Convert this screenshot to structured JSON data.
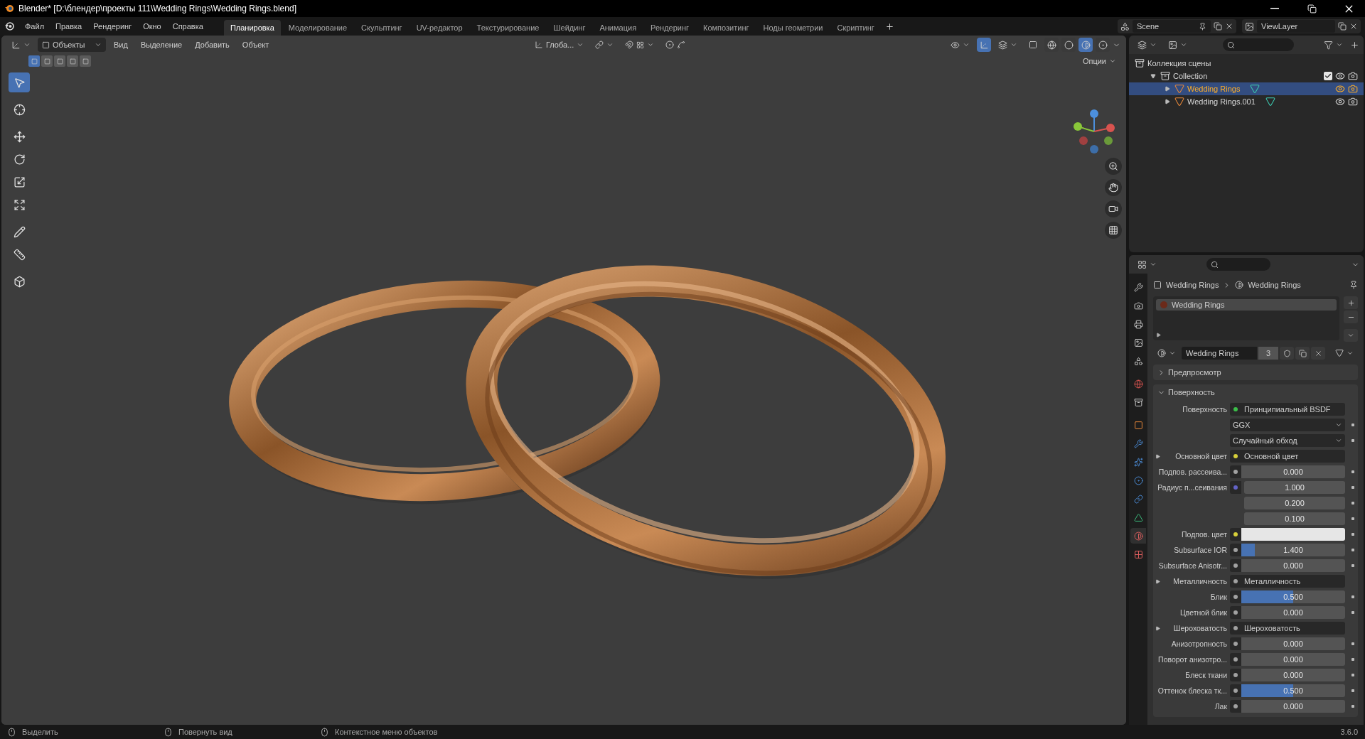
{
  "window": {
    "title": "Blender* [D:\\блендер\\проекты 111\\Wedding Rings\\Wedding Rings.blend]"
  },
  "menu": [
    "Файл",
    "Правка",
    "Рендеринг",
    "Окно",
    "Справка"
  ],
  "workspaces": [
    {
      "label": "Планировка",
      "selected": true
    },
    {
      "label": "Моделирование",
      "selected": false
    },
    {
      "label": "Скульптинг",
      "selected": false
    },
    {
      "label": "UV-редактор",
      "selected": false
    },
    {
      "label": "Текстурирование",
      "selected": false
    },
    {
      "label": "Шейдинг",
      "selected": false
    },
    {
      "label": "Анимация",
      "selected": false
    },
    {
      "label": "Рендеринг",
      "selected": false
    },
    {
      "label": "Композитинг",
      "selected": false
    },
    {
      "label": "Ноды геометрии",
      "selected": false
    },
    {
      "label": "Скриптинг",
      "selected": false
    }
  ],
  "scene": "Scene",
  "view_layer": "ViewLayer",
  "viewport": {
    "mode": "Объекты",
    "menus": [
      "Вид",
      "Выделение",
      "Добавить",
      "Объект"
    ],
    "orientation": "Глоба...",
    "options": "Опции",
    "select_modes": [
      {
        "selected": true
      },
      {
        "selected": false
      },
      {
        "selected": false
      },
      {
        "selected": false
      },
      {
        "selected": false
      }
    ],
    "gizmo_toggle": {
      "on": true
    },
    "shading": [
      {
        "kind": "wireframe",
        "selected": false
      },
      {
        "kind": "solid",
        "selected": false
      },
      {
        "kind": "material",
        "selected": true
      },
      {
        "kind": "rendered",
        "selected": false
      }
    ]
  },
  "toolbar": [
    {
      "kind": "select",
      "selected": true
    },
    {
      "kind": "cursor",
      "selected": false
    },
    {
      "kind": "move",
      "selected": false
    },
    {
      "kind": "rotate",
      "selected": false
    },
    {
      "kind": "scale",
      "selected": false
    },
    {
      "kind": "transform",
      "selected": false
    },
    {
      "kind": "annotate",
      "selected": false
    },
    {
      "kind": "measure",
      "selected": false
    },
    {
      "kind": "add_cube",
      "selected": false
    }
  ],
  "outliner": {
    "label": "Коллекция сцены",
    "children": [
      {
        "label": "Collection",
        "kind": "collection",
        "expanded": true,
        "checked": true,
        "selected": false,
        "children": [
          {
            "label": "Wedding Rings",
            "kind": "mesh",
            "expanded": false,
            "selected": true
          },
          {
            "label": "Wedding Rings.001",
            "kind": "mesh",
            "expanded": false,
            "selected": false
          }
        ]
      }
    ]
  },
  "properties": {
    "tabs": [
      {
        "kind": "tool",
        "selected": false
      },
      {
        "kind": "render",
        "selected": false
      },
      {
        "kind": "output",
        "selected": false
      },
      {
        "kind": "view_layer",
        "selected": false
      },
      {
        "kind": "scene",
        "selected": false
      },
      {
        "kind": "world",
        "selected": false
      },
      {
        "kind": "collection",
        "selected": false
      },
      {
        "kind": "object",
        "selected": false
      },
      {
        "kind": "modifier",
        "selected": false
      },
      {
        "kind": "particles",
        "selected": false
      },
      {
        "kind": "physics",
        "selected": false
      },
      {
        "kind": "constraints",
        "selected": false
      },
      {
        "kind": "data",
        "selected": false
      },
      {
        "kind": "material",
        "selected": true
      },
      {
        "kind": "texture",
        "selected": false
      }
    ],
    "breadcrumb": [
      "Wedding Rings",
      "Wedding Rings"
    ],
    "slots": [
      {
        "label": "Wedding Rings",
        "selected": true
      }
    ],
    "material": "Wedding Rings",
    "users": "3",
    "panels": [
      {
        "title": "Предпросмотр",
        "expanded": false
      },
      {
        "title": "Поверхность",
        "expanded": true
      }
    ],
    "rows": [
      {
        "kind": "link",
        "label": "Поверхность",
        "color": "#3cbf4a",
        "value": "Принципиальный BSDF",
        "expandable": false
      },
      {
        "kind": "dropdown",
        "value": "GGX"
      },
      {
        "kind": "dropdown",
        "value": "Случайный обход"
      },
      {
        "kind": "link",
        "label": "Основной цвет",
        "color": "#d6cf3a",
        "value": "Основной цвет",
        "expandable": true
      },
      {
        "kind": "slider",
        "label": "Подпов. рассеива...",
        "color": "#a1a1a1",
        "value": "0.000",
        "level": 0
      },
      {
        "kind": "vector",
        "label": "Радиус п...сеивания",
        "color": "#6363c7",
        "values": [
          "1.000",
          "0.200",
          "0.100"
        ]
      },
      {
        "kind": "swatch",
        "label": "Подпов. цвет",
        "color": "#d6cf3a"
      },
      {
        "kind": "slider",
        "label": "Subsurface IOR",
        "color": "#a1a1a1",
        "value": "1.400",
        "level": 0.13
      },
      {
        "kind": "slider",
        "label": "Subsurface Anisotr...",
        "color": "#a1a1a1",
        "value": "0.000",
        "level": 0
      },
      {
        "kind": "link",
        "label": "Металличность",
        "color": "#a1a1a1",
        "value": "Металличность",
        "expandable": true
      },
      {
        "kind": "slider",
        "label": "Блик",
        "color": "#a1a1a1",
        "value": "0.500",
        "level": 0.5
      },
      {
        "kind": "slider",
        "label": "Цветной блик",
        "color": "#a1a1a1",
        "value": "0.000",
        "level": 0
      },
      {
        "kind": "link",
        "label": "Шероховатость",
        "color": "#a1a1a1",
        "value": "Шероховатость",
        "expandable": true
      },
      {
        "kind": "slider",
        "label": "Анизотропность",
        "color": "#a1a1a1",
        "value": "0.000",
        "level": 0
      },
      {
        "kind": "slider",
        "label": "Поворот анизотро...",
        "color": "#a1a1a1",
        "value": "0.000",
        "level": 0
      },
      {
        "kind": "slider",
        "label": "Блеск ткани",
        "color": "#a1a1a1",
        "value": "0.000",
        "level": 0
      },
      {
        "kind": "slider",
        "label": "Оттенок блеска тк...",
        "color": "#a1a1a1",
        "value": "0.500",
        "level": 0.5
      },
      {
        "kind": "slider",
        "label": "Лак",
        "color": "#a1a1a1",
        "value": "0.000",
        "level": 0
      }
    ]
  },
  "status_bar": {
    "hints": [
      "Выделить",
      "Повернуть вид",
      "Контекстное меню объектов"
    ],
    "version": "3.6.0"
  }
}
